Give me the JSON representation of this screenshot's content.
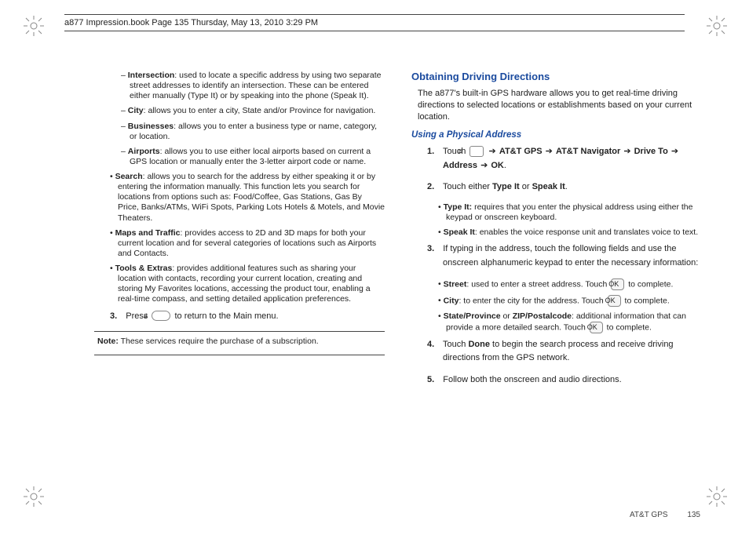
{
  "top_header": "a877 Impression.book  Page 135  Thursday, May 13, 2010  3:29 PM",
  "left": {
    "items": [
      {
        "type": "sub",
        "bold": "Intersection",
        "text": ": used to locate a specific address by using two separate street addresses to identify an intersection. These can be entered either manually (Type It) or by speaking into the phone (Speak It)."
      },
      {
        "type": "sub",
        "bold": "City",
        "text": ": allows you to enter a city, State and/or Province for navigation."
      },
      {
        "type": "sub",
        "bold": "Businesses",
        "text": ": allows you to enter a business type or name, category, or location."
      },
      {
        "type": "sub",
        "bold": "Airports",
        "text": ": allows you to use either local airports based on current a GPS location or manually enter the 3-letter airport code or name."
      },
      {
        "type": "bullet",
        "bold": "Search",
        "text": ": allows you to search for the address by either speaking it or by entering the information manually. This function lets you search for locations from options such as: Food/Coffee, Gas Stations, Gas By Price, Banks/ATMs, WiFi Spots, Parking Lots Hotels & Motels, and Movie Theaters."
      },
      {
        "type": "bullet",
        "bold": "Maps and Traffic",
        "text": ": provides access to 2D and 3D maps for both your current location and for several categories of locations such as Airports and Contacts."
      },
      {
        "type": "bullet",
        "bold": "Tools & Extras",
        "text": ": provides additional features such as sharing your location with contacts, recording your current location, creating and storing My Favorites locations, accessing the product tour, enabling a real-time compass, and setting detailed application preferences."
      }
    ],
    "step3_num": "3.",
    "step3_before": "Press ",
    "step3_after": " to return to the Main menu.",
    "note_label": "Note:",
    "note_text": " These services require the purchase of a subscription."
  },
  "right": {
    "section_title": "Obtaining Driving Directions",
    "intro": "The a877's built-in GPS hardware allows you to get real-time driving directions to selected locations or establishments based on your current location.",
    "subsection_title": "Using a Physical Address",
    "step1": {
      "num": "1.",
      "before": "Touch ",
      "path1": " AT&T GPS ",
      "path2": " AT&T Navigator ",
      "path3": " Drive To ",
      "path4": " Address ",
      "path5": " OK",
      "end": "."
    },
    "step2": {
      "num": "2.",
      "text_before": "Touch either ",
      "opt1": "Type It",
      "mid": " or ",
      "opt2": "Speak It",
      "end": "."
    },
    "step2_bullets": [
      {
        "bold": "Type It:",
        "text": " requires that you enter the physical address using either the keypad or onscreen keyboard."
      },
      {
        "bold": "Speak It",
        "text": ": enables the voice response unit and translates voice to text."
      }
    ],
    "step3": {
      "num": "3.",
      "text": "If typing in the address, touch the following fields and use the onscreen alphanumeric keypad to enter the necessary information:"
    },
    "step3_bullets": [
      {
        "bold": "Street",
        "before": ": used to enter a street address. Touch ",
        "key": "OK",
        "after": " to complete."
      },
      {
        "bold": "City",
        "before": ": to enter the city for the address. Touch ",
        "key": "OK",
        "after": " to complete."
      },
      {
        "bold": "State/Province",
        "mid_or": " or ",
        "bold2": "ZIP/Postalcode",
        "before": ": additional information that can provide a more detailed search. Touch ",
        "key": "OK",
        "after": " to complete."
      }
    ],
    "step4": {
      "num": "4.",
      "before": "Touch ",
      "bold": "Done",
      "after": " to begin the search process and receive driving directions from the GPS network."
    },
    "step5": {
      "num": "5.",
      "text": "Follow both the onscreen and audio directions."
    }
  },
  "footer": {
    "section": "AT&T GPS",
    "page": "135"
  },
  "arrow": "➔"
}
